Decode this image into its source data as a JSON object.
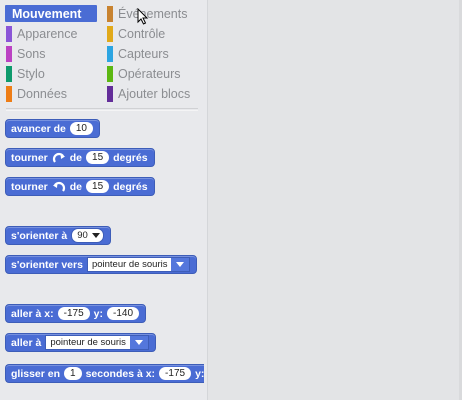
{
  "categories": [
    {
      "label": "Mouvement",
      "color": "#4a6cd4",
      "selected": true
    },
    {
      "label": "Apparence",
      "color": "#8a55d7"
    },
    {
      "label": "Sons",
      "color": "#bb42c3"
    },
    {
      "label": "Stylo",
      "color": "#0e9a6c"
    },
    {
      "label": "Données",
      "color": "#ee7d16"
    },
    {
      "label": "Événements",
      "color": "#c88330"
    },
    {
      "label": "Contrôle",
      "color": "#e1a91a"
    },
    {
      "label": "Capteurs",
      "color": "#2ca5e2"
    },
    {
      "label": "Opérateurs",
      "color": "#5cb712"
    },
    {
      "label": "Ajouter blocs",
      "color": "#632d99"
    }
  ],
  "blocks": {
    "move": {
      "w1": "avancer de",
      "v1": "10"
    },
    "turn_right": {
      "w1": "tourner",
      "w2": "de",
      "v1": "15",
      "w3": "degrés"
    },
    "turn_left": {
      "w1": "tourner",
      "w2": "de",
      "v1": "15",
      "w3": "degrés"
    },
    "point_dir": {
      "w1": "s'orienter à",
      "v1": "90"
    },
    "point_towards": {
      "w1": "s'orienter vers",
      "v1": "pointeur de souris"
    },
    "goto_xy": {
      "w1": "aller à x:",
      "v1": "-175",
      "w2": "y:",
      "v2": "-140"
    },
    "goto": {
      "w1": "aller à",
      "v1": "pointeur de souris"
    },
    "glide": {
      "w1": "glisser en",
      "v1": "1",
      "w2": "secondes à x:",
      "v2": "-175",
      "w3": "y:"
    }
  }
}
